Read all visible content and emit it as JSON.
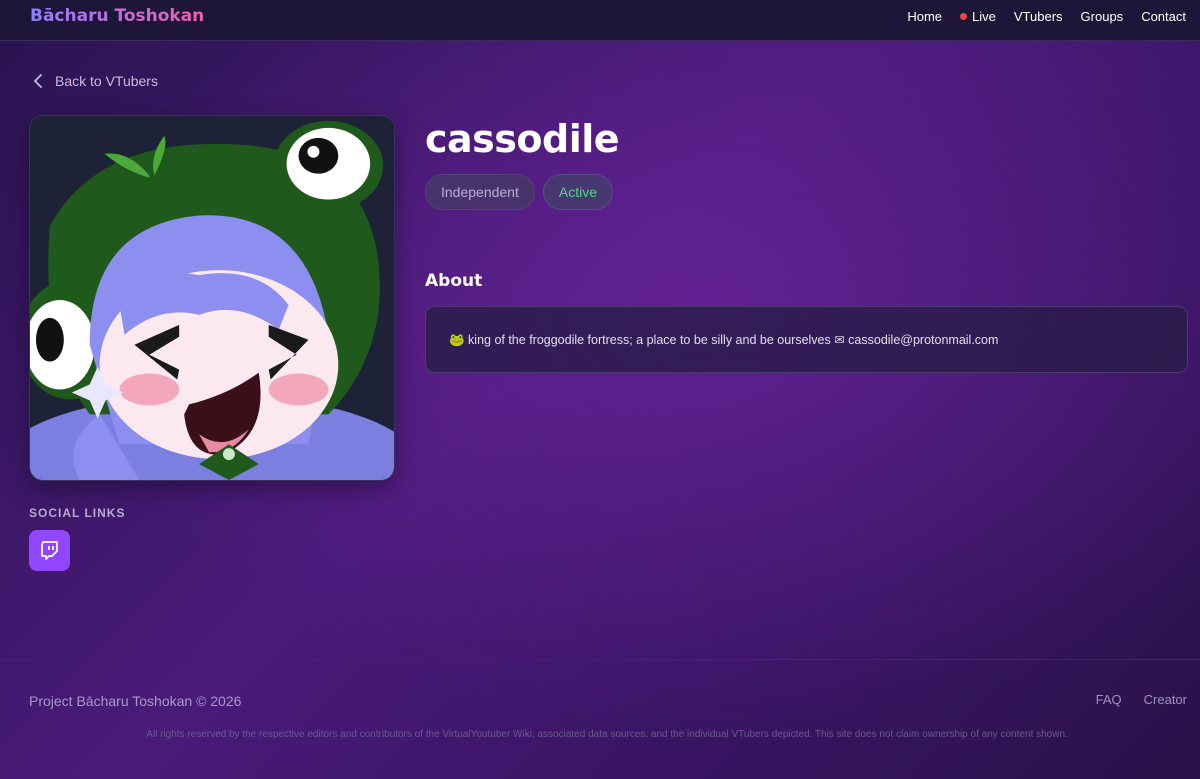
{
  "navbar": {
    "brand": "Bācharu Toshokan",
    "links": [
      {
        "label": "Home"
      },
      {
        "label": "Live"
      },
      {
        "label": "VTubers"
      },
      {
        "label": "Groups"
      },
      {
        "label": "Contact"
      }
    ],
    "live_dot_color": "#ef4444"
  },
  "back_link": {
    "label": "Back to VTubers",
    "icon": "chevron-left-icon"
  },
  "profile": {
    "name": "cassodile",
    "badges": [
      {
        "label": "Independent"
      },
      {
        "label": "Active",
        "color": "#4ade80"
      }
    ]
  },
  "about": {
    "title": "About",
    "text": "🐸 king of the froggodile fortress; a place to be silly and be ourselves ✉ cassodile@protonmail.com"
  },
  "social": {
    "title": "SOCIAL LINKS",
    "links": [
      {
        "platform": "twitch",
        "icon": "twitch-icon",
        "color": "#9146ff"
      }
    ]
  },
  "footer": {
    "copyright": "Project Bācharu Toshokan © 2026",
    "links": [
      {
        "label": "FAQ"
      },
      {
        "label": "Creator"
      }
    ],
    "disclaimer": "All rights reserved by the respective editors and contributors of the VirtualYoutuber Wiki, associated data sources, and the individual VTubers depicted. This site does not claim ownership of any content shown."
  }
}
